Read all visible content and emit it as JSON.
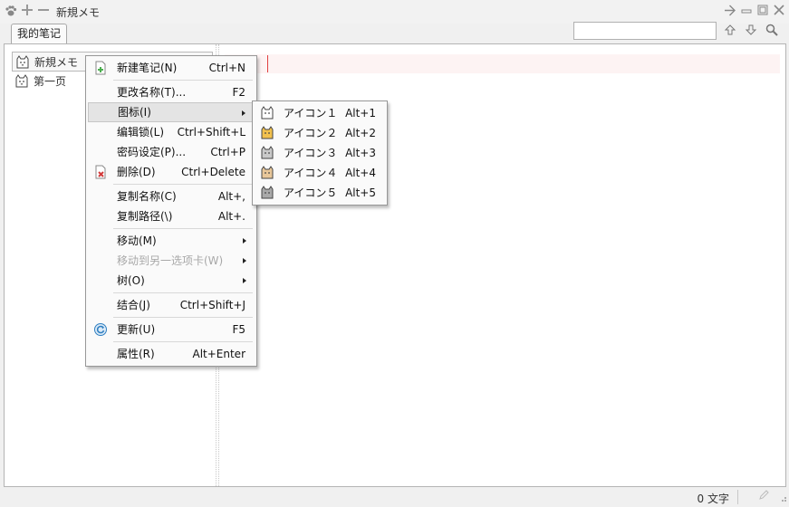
{
  "titlebar": {
    "title": "新規メモ"
  },
  "tabs": [
    {
      "label": "我的笔记"
    }
  ],
  "search": {
    "value": "",
    "placeholder": ""
  },
  "tree": [
    {
      "label": "新規メモ",
      "selected": true
    },
    {
      "label": "第一页",
      "selected": false
    }
  ],
  "context_menu": {
    "new_note": {
      "label": "新建笔记(N)",
      "shortcut": "Ctrl+N"
    },
    "rename": {
      "label": "更改名称(T)...",
      "shortcut": "F2"
    },
    "icon": {
      "label": "图标(I)"
    },
    "edit_lock": {
      "label": "编辑锁(L)",
      "shortcut": "Ctrl+Shift+L"
    },
    "password": {
      "label": "密码设定(P)...",
      "shortcut": "Ctrl+P"
    },
    "delete": {
      "label": "删除(D)",
      "shortcut": "Ctrl+Delete"
    },
    "copy_name": {
      "label": "复制名称(C)",
      "shortcut": "Alt+,"
    },
    "copy_path": {
      "label": "复制路径(\\)",
      "shortcut": "Alt+."
    },
    "move": {
      "label": "移动(M)"
    },
    "move_to_tab": {
      "label": "移动到另一选项卡(W)"
    },
    "tree": {
      "label": "树(O)"
    },
    "join": {
      "label": "结合(J)",
      "shortcut": "Ctrl+Shift+J"
    },
    "refresh": {
      "label": "更新(U)",
      "shortcut": "F5"
    },
    "properties": {
      "label": "属性(R)",
      "shortcut": "Alt+Enter"
    }
  },
  "icon_submenu": [
    {
      "label": "アイコン１",
      "shortcut": "Alt+1",
      "color": "#ffffff"
    },
    {
      "label": "アイコン２",
      "shortcut": "Alt+2",
      "color": "#f2c14e"
    },
    {
      "label": "アイコン３",
      "shortcut": "Alt+3",
      "color": "#c9c9c9"
    },
    {
      "label": "アイコン４",
      "shortcut": "Alt+4",
      "color": "#e8c79a"
    },
    {
      "label": "アイコン５",
      "shortcut": "Alt+5",
      "color": "#a9a9a9"
    }
  ],
  "status": {
    "char_count": "0 文字"
  },
  "colors": {
    "accent_caret": "#e04040",
    "new_icon": "#4caf50",
    "delete_icon": "#d23b3b",
    "refresh_icon": "#2f7fc1"
  }
}
